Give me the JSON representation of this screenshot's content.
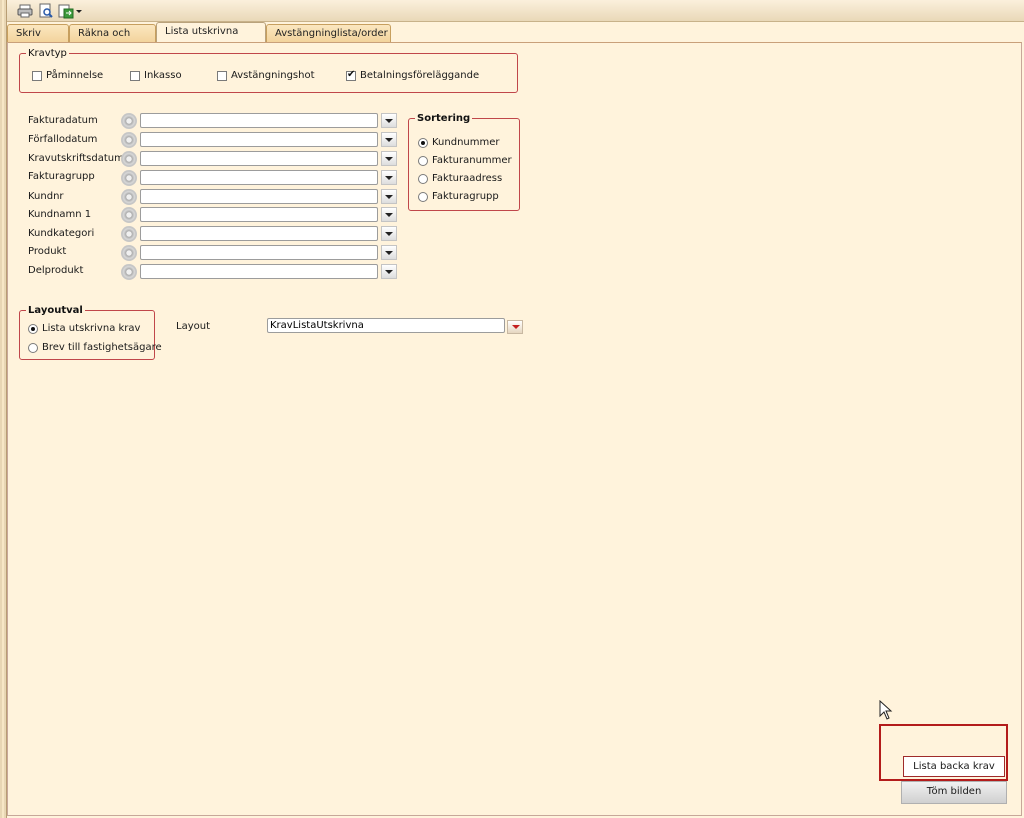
{
  "toolbar": {
    "icons": [
      "printer-icon",
      "print-preview-icon",
      "export-icon",
      "dropdown-arrow-icon"
    ]
  },
  "tabs": [
    {
      "label": "Skriv krav",
      "active": false
    },
    {
      "label": "Räkna och lista",
      "active": false
    },
    {
      "label": "Lista utskrivna krav",
      "active": true
    },
    {
      "label": "Avstängninglista/order",
      "active": false
    }
  ],
  "kravtyp": {
    "legend": "Kravtyp",
    "options": [
      {
        "label": "Påminnelse",
        "checked": false
      },
      {
        "label": "Inkasso",
        "checked": false
      },
      {
        "label": "Avstängningshot",
        "checked": false
      },
      {
        "label": "Betalningsföreläggande",
        "checked": true
      }
    ]
  },
  "filters": [
    {
      "label": "Fakturadatum",
      "value": ""
    },
    {
      "label": "Förfallodatum",
      "value": ""
    },
    {
      "label": "Kravutskriftsdatum",
      "value": ""
    },
    {
      "label": "Fakturagrupp",
      "value": ""
    },
    {
      "label": "Kundnr",
      "value": ""
    },
    {
      "label": "Kundnamn 1",
      "value": ""
    },
    {
      "label": "Kundkategori",
      "value": ""
    },
    {
      "label": "Produkt",
      "value": ""
    },
    {
      "label": "Delprodukt",
      "value": ""
    }
  ],
  "sortering": {
    "legend": "Sortering",
    "options": [
      {
        "label": "Kundnummer",
        "selected": true
      },
      {
        "label": "Fakturanummer",
        "selected": false
      },
      {
        "label": "Fakturaadress",
        "selected": false
      },
      {
        "label": "Fakturagrupp",
        "selected": false
      }
    ]
  },
  "layoutval": {
    "legend": "Layoutval",
    "options": [
      {
        "label": "Lista utskrivna krav",
        "selected": true
      },
      {
        "label": "Brev till fastighetsägare",
        "selected": false
      }
    ]
  },
  "layout": {
    "label": "Layout",
    "value": "KravListaUtskrivna"
  },
  "buttons": {
    "lista_backa": "Lista backa krav",
    "tom_bilden": "Töm bilden"
  },
  "colors": {
    "background": "#fff3dc",
    "group_border": "#c0464a",
    "highlight": "#b31b1b"
  }
}
